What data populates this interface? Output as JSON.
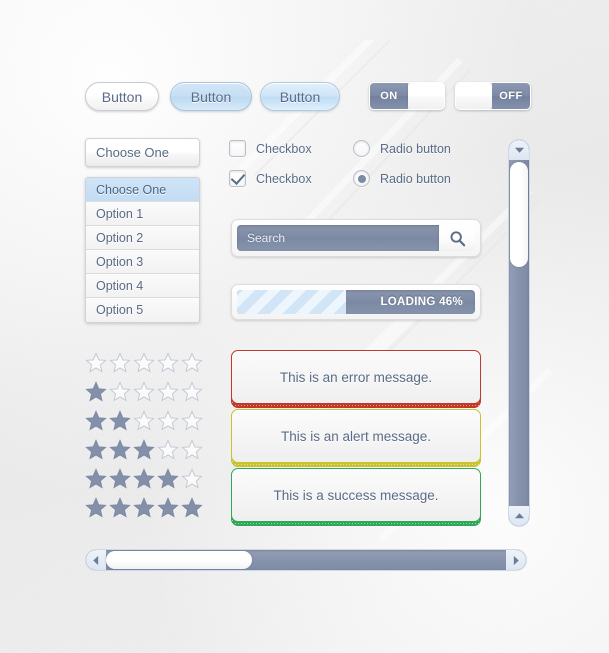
{
  "theme": {
    "text_color": "#5b6c87",
    "accent_blue": "#7d8aa6",
    "light_blue": "#c6dff4",
    "error_color": "#c0392b",
    "alert_color": "#c8c32e",
    "success_color": "#2fa85a",
    "background": "#efefef"
  },
  "buttons": [
    {
      "label": "Button",
      "style": "white"
    },
    {
      "label": "Button",
      "style": "blue"
    },
    {
      "label": "Button",
      "style": "blue-light"
    }
  ],
  "toggles": [
    {
      "label": "ON",
      "state": "on",
      "knob_side": "right"
    },
    {
      "label": "OFF",
      "state": "off",
      "knob_side": "left"
    }
  ],
  "select": {
    "header_label": "Choose One",
    "options": [
      {
        "label": "Choose One",
        "selected": true
      },
      {
        "label": "Option 1",
        "selected": false
      },
      {
        "label": "Option 2",
        "selected": false
      },
      {
        "label": "Option 3",
        "selected": false
      },
      {
        "label": "Option 4",
        "selected": false
      },
      {
        "label": "Option 5",
        "selected": false
      }
    ]
  },
  "checkboxes": [
    {
      "label": "Checkbox",
      "checked": false
    },
    {
      "label": "Checkbox",
      "checked": true
    }
  ],
  "radios": [
    {
      "label": "Radio button",
      "checked": false
    },
    {
      "label": "Radio button",
      "checked": true
    }
  ],
  "search": {
    "placeholder": "Search",
    "value": "",
    "icon": "search-icon"
  },
  "progress": {
    "label": "LOADING 46%",
    "percent": 46
  },
  "star_ratings": [
    {
      "filled": 0,
      "total": 5
    },
    {
      "filled": 1,
      "total": 5
    },
    {
      "filled": 2,
      "total": 5
    },
    {
      "filled": 3,
      "total": 5
    },
    {
      "filled": 4,
      "total": 5
    },
    {
      "filled": 5,
      "total": 5
    }
  ],
  "messages": [
    {
      "type": "error",
      "text": "This is an error message.",
      "color": "#c0392b"
    },
    {
      "type": "alert",
      "text": "This is an alert message.",
      "color": "#c8c32e"
    },
    {
      "type": "success",
      "text": "This is a success message.",
      "color": "#2fa85a"
    }
  ],
  "scrollbars": {
    "vertical": {
      "up_icon": "chevron-up-icon",
      "down_icon": "chevron-down-icon",
      "thumb_position_percent": 4,
      "thumb_size_percent": 27
    },
    "horizontal": {
      "left_icon": "chevron-left-icon",
      "right_icon": "chevron-right-icon",
      "thumb_position_percent": 0,
      "thumb_size_percent": 33
    }
  }
}
